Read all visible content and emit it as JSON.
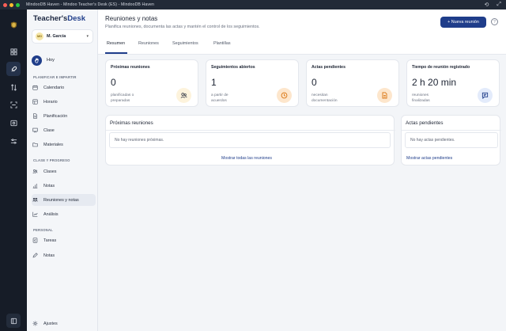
{
  "window": {
    "title": "MindooDB Haven - Mindoo Teacher's Desk (ES) - MindooDB Haven",
    "dots": [
      "#ff5f57",
      "#febc2e",
      "#28c840"
    ]
  },
  "colors": {
    "accent": "#1f3d8a",
    "sidebar_bg": "#f4f6f9",
    "rail_bg": "#161c27"
  },
  "logo": {
    "part1": "Teacher's",
    "part2": "Desk"
  },
  "user": {
    "initials": "MG",
    "name": "M. García"
  },
  "hoy": {
    "label": "Hoy"
  },
  "sidebar": {
    "section1": "PLANIFICAR E IMPARTIR",
    "items1": [
      {
        "label": "Calendario",
        "icon": "calendar-icon"
      },
      {
        "label": "Horario",
        "icon": "clock-icon"
      },
      {
        "label": "Planificación",
        "icon": "document-icon"
      },
      {
        "label": "Clase",
        "icon": "board-icon"
      },
      {
        "label": "Materiales",
        "icon": "folder-icon"
      }
    ],
    "section2": "CLASE Y PROGRESO",
    "items2": [
      {
        "label": "Clases",
        "icon": "users-icon"
      },
      {
        "label": "Notas",
        "icon": "chart-icon"
      },
      {
        "label": "Reuniones y notas",
        "icon": "meeting-icon",
        "active": true
      },
      {
        "label": "Análisis",
        "icon": "trend-icon"
      }
    ],
    "section3": "PERSONAL",
    "items3": [
      {
        "label": "Tareas",
        "icon": "checklist-icon"
      },
      {
        "label": "Notas",
        "icon": "note-icon"
      }
    ],
    "settings": "Ajustes"
  },
  "header": {
    "title": "Reuniones y notas",
    "subtitle": "Planifica reuniones, documenta las actas y mantén el control de los seguimientos.",
    "new_button": "+ Nueva reunión",
    "help": "?"
  },
  "tabs": [
    "Resumen",
    "Reuniones",
    "Seguimientos",
    "Plantillas"
  ],
  "cards": [
    {
      "title": "Próximas reuniones",
      "value": "0",
      "sub1": "planificadas o",
      "sub2": "preparadas",
      "icon": "users-icon",
      "icon_bg": "#fdf3dc",
      "icon_color": "#3a3f4b"
    },
    {
      "title": "Seguimientos abiertos",
      "value": "1",
      "sub1": "a partir de",
      "sub2": "acuerdos",
      "icon": "clock-icon",
      "icon_bg": "#fde6cc",
      "icon_color": "#d9730d"
    },
    {
      "title": "Actas pendientes",
      "value": "0",
      "sub1": "necesitan",
      "sub2": "documentación",
      "icon": "document-icon",
      "icon_bg": "#fde6cc",
      "icon_color": "#d9730d"
    },
    {
      "title": "Tiempo de reunión registrado",
      "value": "2 h 20 min",
      "sub1": "reuniones",
      "sub2": "finalizadas",
      "icon": "chat-icon",
      "icon_bg": "#e3ebfb",
      "icon_color": "#1f3d8a"
    }
  ],
  "panel_meetings": {
    "title": "Próximas reuniones",
    "empty": "No hay reuniones próximas.",
    "link": "Mostrar todas las reuniones"
  },
  "panel_minutes": {
    "title": "Actas pendientes",
    "empty": "No hay actas pendientes.",
    "link": "Mostrar actas pendientes"
  }
}
